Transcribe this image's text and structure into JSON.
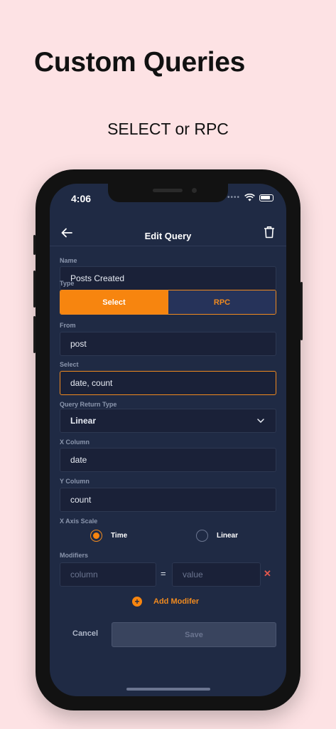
{
  "promo": {
    "headline": "Custom Queries",
    "subhead": "SELECT or RPC"
  },
  "status": {
    "time": "4:06"
  },
  "nav": {
    "title": "Edit Query"
  },
  "form": {
    "name_label": "Name",
    "name_value": "Posts Created",
    "type_label": "Type",
    "type_select": "Select",
    "type_rpc": "RPC",
    "from_label": "From",
    "from_value": "post",
    "select_label": "Select",
    "select_value": "date, count",
    "return_type_label": "Query Return Type",
    "return_type_value": "Linear",
    "x_column_label": "X Column",
    "x_column_value": "date",
    "y_column_label": "Y Column",
    "y_column_value": "count",
    "x_axis_label": "X Axis Scale",
    "x_axis_time": "Time",
    "x_axis_linear": "Linear",
    "modifiers_label": "Modifiers",
    "modifier_column_placeholder": "column",
    "modifier_eq": "=",
    "modifier_value_placeholder": "value",
    "add_modifier": "Add Modifer",
    "cancel": "Cancel",
    "save": "Save"
  },
  "colors": {
    "accent": "#f7850f",
    "background": "#1f2a44",
    "promo_bg": "#fde2e4"
  }
}
